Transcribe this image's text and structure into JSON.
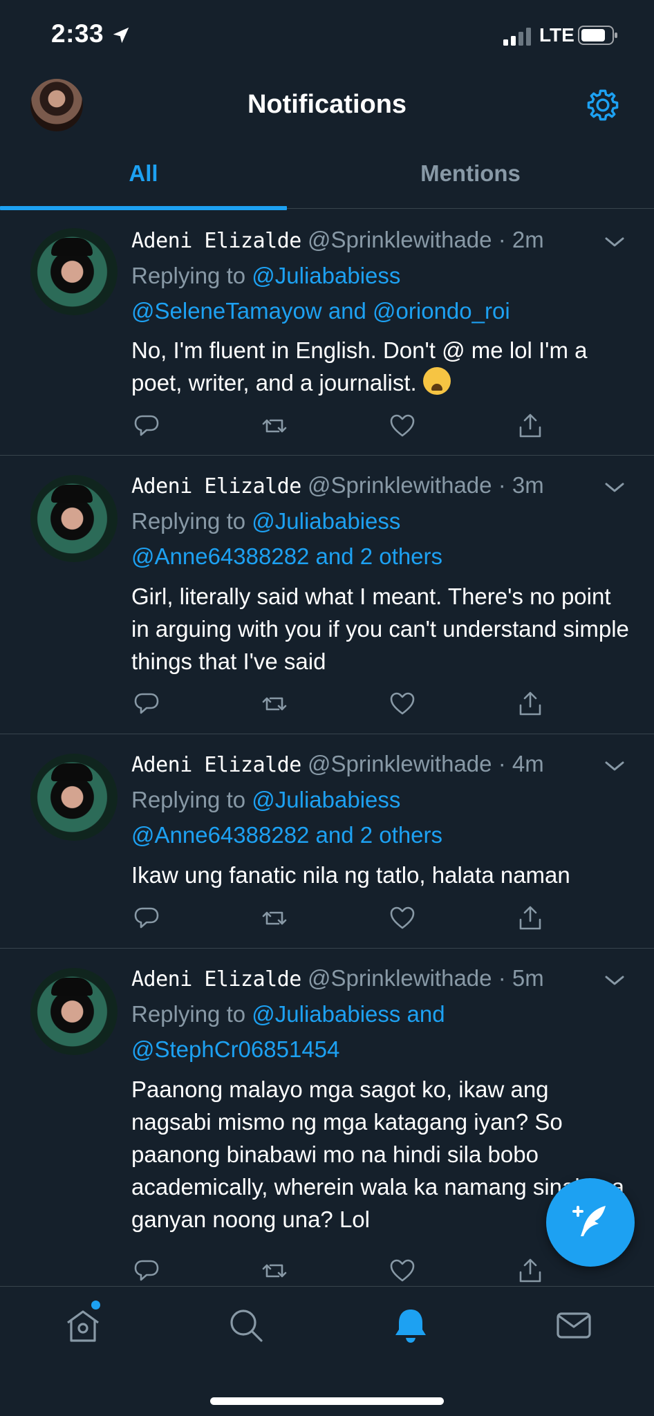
{
  "status_bar": {
    "time": "2:33",
    "network": "LTE"
  },
  "header": {
    "title": "Notifications"
  },
  "tabs": [
    {
      "label": "All",
      "active": true
    },
    {
      "label": "Mentions",
      "active": false
    }
  ],
  "tweets": [
    {
      "name": "Adeni Elizalde",
      "handle": "@Sprinklewithade",
      "dot": "·",
      "time": "2m",
      "reply_prefix": "Replying to",
      "reply_l1": "@Juliababiess",
      "reply_l2_a": "@SeleneTamayow",
      "reply_l2_and": "and",
      "reply_l2_b": "@oriondo_roi",
      "text": "No, I'm fluent in English. Don't @ me lol I'm a poet, writer, and a journalist.",
      "emoji": "weary-face-emoji"
    },
    {
      "name": "Adeni Elizalde",
      "handle": "@Sprinklewithade",
      "dot": "·",
      "time": "3m",
      "reply_prefix": "Replying to",
      "reply_l1": "@Juliababiess",
      "reply_l2": "@Anne64388282 and 2 others",
      "text": "Girl, literally said what I meant. There's no point in arguing with you if you can't understand simple things that I've said"
    },
    {
      "name": "Adeni Elizalde",
      "handle": "@Sprinklewithade",
      "dot": "·",
      "time": "4m",
      "reply_prefix": "Replying to",
      "reply_l1": "@Juliababiess",
      "reply_l2": "@Anne64388282 and 2 others",
      "text": "Ikaw ung fanatic nila ng tatlo, halata naman"
    },
    {
      "name": "Adeni Elizalde",
      "handle": "@Sprinklewithade",
      "dot": "·",
      "time": "5m",
      "reply_prefix": "Replying to",
      "reply_l1": "@Juliababiess and",
      "reply_l2": "@StephCr06851454",
      "text": "Paanong malayo mga sagot ko, ikaw ang nagsabi mismo ng mga katagang iyan? So paanong binabawi mo na hindi sila bobo academically, wherein wala ka namang sinabi na ganyan noong una? Lol"
    }
  ],
  "colors": {
    "background": "#15202b",
    "accent": "#1da1f2",
    "muted": "#8899a6",
    "divider": "#38444d"
  },
  "icons": [
    "location-arrow-icon",
    "signal-icon",
    "battery-icon",
    "gear-icon",
    "chevron-down-icon",
    "reply-icon",
    "retweet-icon",
    "like-icon",
    "share-icon",
    "compose-icon",
    "home-icon",
    "search-icon",
    "bell-icon",
    "mail-icon"
  ]
}
